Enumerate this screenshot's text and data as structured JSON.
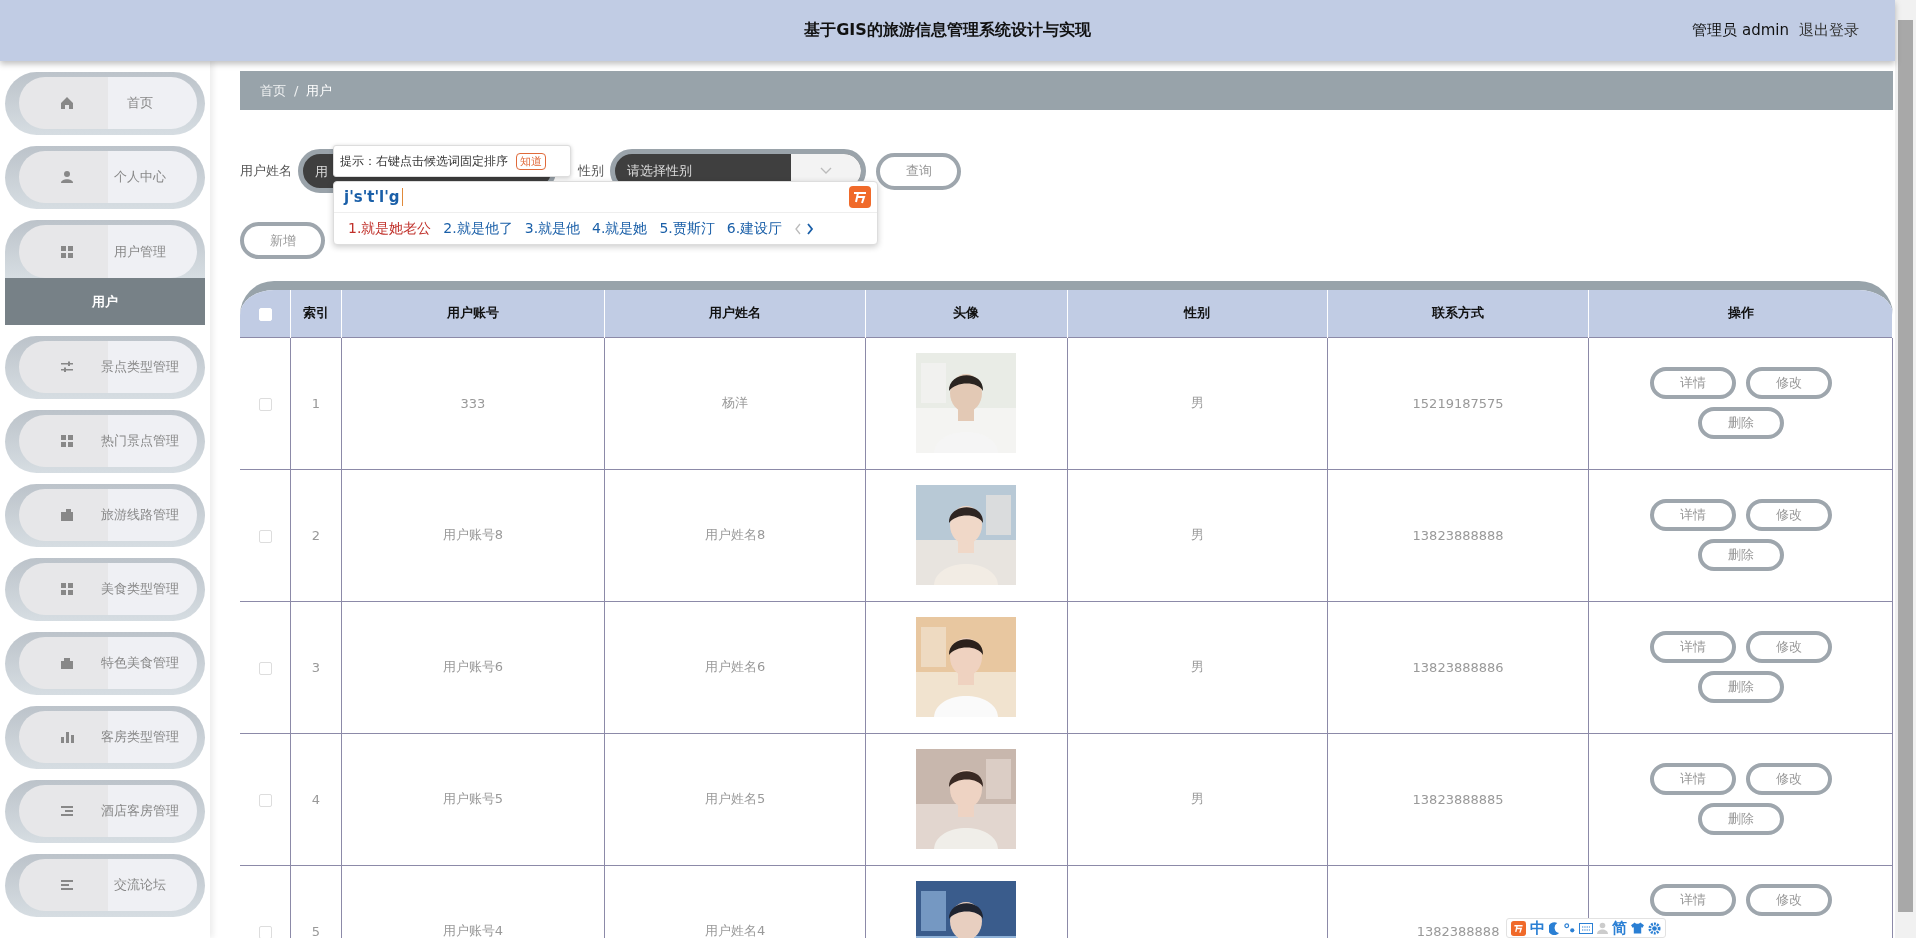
{
  "header": {
    "title": "基于GIS的旅游信息管理系统设计与实现",
    "user": "管理员 admin",
    "logout": "退出登录"
  },
  "sidebar": {
    "items": [
      {
        "label": "首页",
        "selected": false,
        "expanded": false
      },
      {
        "label": "个人中心",
        "selected": false,
        "expanded": false
      },
      {
        "label": "用户管理",
        "selected": false,
        "expanded": true,
        "children": [
          {
            "label": "用户",
            "selected": true
          }
        ]
      },
      {
        "label": "景点类型管理",
        "selected": false,
        "expanded": false
      },
      {
        "label": "热门景点管理",
        "selected": false,
        "expanded": false
      },
      {
        "label": "旅游线路管理",
        "selected": false,
        "expanded": false
      },
      {
        "label": "美食类型管理",
        "selected": false,
        "expanded": false
      },
      {
        "label": "特色美食管理",
        "selected": false,
        "expanded": false
      },
      {
        "label": "客房类型管理",
        "selected": false,
        "expanded": false
      },
      {
        "label": "酒店客房管理",
        "selected": false,
        "expanded": false
      },
      {
        "label": "交流论坛",
        "selected": false,
        "expanded": false
      }
    ]
  },
  "breadcrumb": {
    "items": [
      "首页",
      "用户"
    ],
    "separator": "/"
  },
  "search": {
    "fields": [
      {
        "kind": "input",
        "label": "用户姓名",
        "placeholder": "用"
      },
      {
        "kind": "select",
        "label": "性别",
        "placeholder": "请选择性别"
      }
    ],
    "button": "查询"
  },
  "toolbar": {
    "buttons": [
      "新增"
    ]
  },
  "table": {
    "select_all_checked": false,
    "columns": [
      "索引",
      "用户账号",
      "用户姓名",
      "头像",
      "性别",
      "联系方式",
      "操作"
    ],
    "rows": [
      {
        "checked": false,
        "index": "1",
        "account": "333",
        "name": "杨洋",
        "avatar": {
          "kind": "picture"
        },
        "gender": "男",
        "phone": "15219187575",
        "actions": [
          "详情",
          "修改",
          "删除"
        ]
      },
      {
        "checked": false,
        "index": "2",
        "account": "用户账号8",
        "name": "用户姓名8",
        "avatar": {
          "kind": "picture"
        },
        "gender": "男",
        "phone": "13823888888",
        "actions": [
          "详情",
          "修改",
          "删除"
        ]
      },
      {
        "checked": false,
        "index": "3",
        "account": "用户账号6",
        "name": "用户姓名6",
        "avatar": {
          "kind": "picture"
        },
        "gender": "男",
        "phone": "13823888886",
        "actions": [
          "详情",
          "修改",
          "删除"
        ]
      },
      {
        "checked": false,
        "index": "4",
        "account": "用户账号5",
        "name": "用户姓名5",
        "avatar": {
          "kind": "picture"
        },
        "gender": "男",
        "phone": "13823888885",
        "actions": [
          "详情",
          "修改",
          "删除"
        ]
      },
      {
        "checked": false,
        "index": "5",
        "account": "用户账号4",
        "name": "用户姓名4",
        "avatar": {
          "kind": "picture"
        },
        "phone": "1382388888",
        "actions": [
          "详情",
          "修改"
        ]
      }
    ]
  },
  "ime": {
    "hint": "提示：右键点击候选词固定排序",
    "hint_button": "知道",
    "input": "j's't'l'g",
    "candidates": [
      {
        "text": "1.就是她老公",
        "selected": true
      },
      {
        "text": "2.就是他了",
        "selected": false
      },
      {
        "text": "3.就是他",
        "selected": false
      },
      {
        "text": "4.就是她",
        "selected": false
      },
      {
        "text": "5.贾斯汀",
        "selected": false
      },
      {
        "text": "6.建设厅",
        "selected": false
      }
    ],
    "status": {
      "mode": "中",
      "script": "简"
    }
  }
}
